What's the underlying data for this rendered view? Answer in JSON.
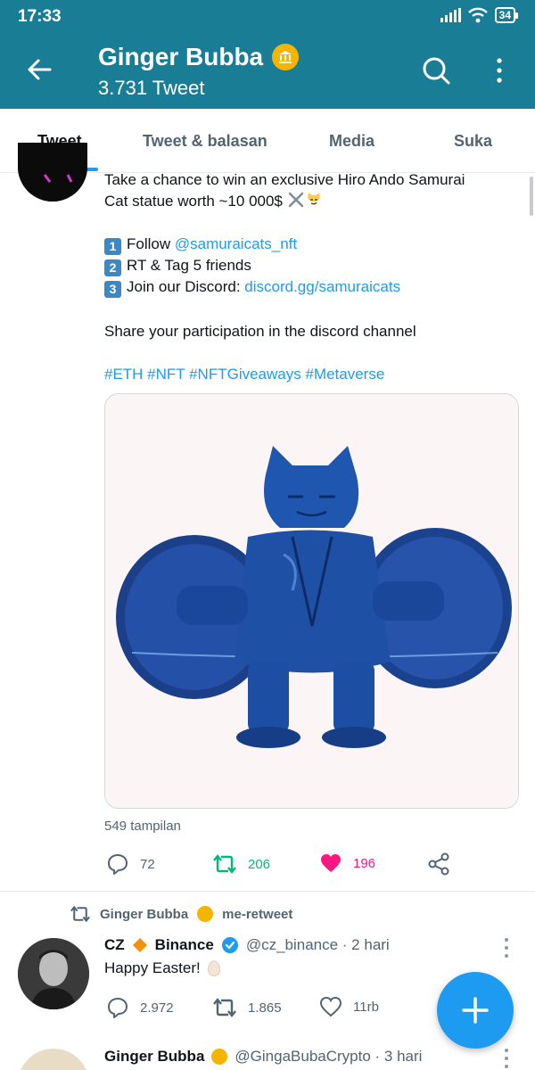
{
  "status_bar": {
    "time": "17:33",
    "battery": "34"
  },
  "header": {
    "title": "Ginger Bubba",
    "subtitle": "3.731 Tweet"
  },
  "tabs": [
    {
      "label": "Tweet",
      "active": true
    },
    {
      "label": "Tweet & balasan",
      "active": false
    },
    {
      "label": "Media",
      "active": false
    },
    {
      "label": "Suka",
      "active": false
    }
  ],
  "tweet1": {
    "line1": "Take a chance to win an exclusive Hiro Ando Samurai",
    "line2": "Cat statue worth ~10 000$",
    "steps": [
      {
        "num": "1",
        "text": "Follow ",
        "link": "@samuraicats_nft"
      },
      {
        "num": "2",
        "text": "RT & Tag 5 friends",
        "link": ""
      },
      {
        "num": "3",
        "text": "Join our Discord: ",
        "link": "discord.gg/samuraicats"
      }
    ],
    "share": "Share your participation in the discord channel",
    "hashtags": "#ETH #NFT #NFTGiveaways #Metaverse",
    "views": "549 tampilan",
    "replies": "72",
    "retweets": "206",
    "likes": "196"
  },
  "tweet2": {
    "retweeted_by": "Ginger Bubba",
    "retweet_label": "me-retweet",
    "author_name": "CZ",
    "author_name2": "Binance",
    "handle": "@cz_binance · 2 hari",
    "text": "Happy Easter!",
    "replies": "2.972",
    "retweets": "1.865",
    "likes": "11rb"
  },
  "tweet3": {
    "author_name": "Ginger Bubba",
    "handle": "@GingaBubaCrypto · 3 hari"
  },
  "colors": {
    "header_bg": "#1a7d96",
    "accent": "#1d9bf0",
    "retweet_green": "#00ba7c",
    "like_pink": "#f91880",
    "gold": "#f4b400"
  }
}
